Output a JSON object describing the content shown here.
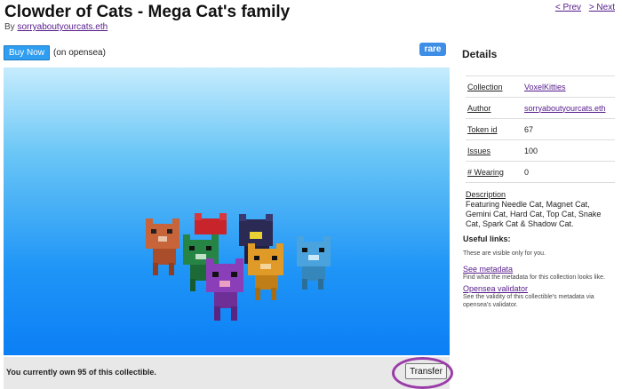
{
  "header": {
    "title": "Clowder of Cats - Mega Cat's family",
    "by_label": "By",
    "author": "sorryaboutyourcats.eth",
    "prev_label": "< Prev",
    "next_label": "> Next"
  },
  "purchase": {
    "buy_label": "Buy Now",
    "note": "(on opensea)",
    "rarity_badge": "rare"
  },
  "viewer": {
    "cats": [
      {
        "name": "Needle Cat",
        "color": "#c8643a"
      },
      {
        "name": "Magnet Cat",
        "color": "#c7252b"
      },
      {
        "name": "Gemini Cat",
        "color": "#268444"
      },
      {
        "name": "Hard Cat",
        "color": "#2a2a55"
      },
      {
        "name": "Top Cat",
        "color": "#e09a28"
      },
      {
        "name": "Snake Cat",
        "color": "#8a3fb8"
      },
      {
        "name": "Spark Cat",
        "color": "#4aa3dc"
      },
      {
        "name": "Shadow Cat",
        "color": "#444444"
      }
    ]
  },
  "footer": {
    "ownership": "You currently own 95 of this collectible.",
    "transfer_label": "Transfer",
    "highlight_color": "#9a3ca8"
  },
  "details": {
    "heading": "Details",
    "rows": [
      {
        "key": "Collection",
        "value": "VoxelKitties",
        "link": true
      },
      {
        "key": "Author",
        "value": "sorryaboutyourcats.eth",
        "link": true
      },
      {
        "key": "Token id",
        "value": "67",
        "link": false
      },
      {
        "key": "Issues",
        "value": "100",
        "link": false
      },
      {
        "key": "# Wearing",
        "value": "0",
        "link": false
      }
    ],
    "description_label": "Description",
    "description": "Featuring Needle Cat, Magnet Cat, Gemini Cat, Hard Cat, Top Cat, Snake Cat, Spark Cat & Shadow Cat."
  },
  "useful_links": {
    "heading": "Useful links:",
    "note": "These are visible only for you.",
    "metadata_label": "See metadata",
    "metadata_desc": "Find what the metadata for this collection looks like.",
    "validator_label": "Opensea validator",
    "validator_desc": "See the validity of this collectible's metadata via opensea's validator."
  },
  "colors": {
    "buy_button": "#2f9df0",
    "badge": "#3e8ee8",
    "link": "#551a8b"
  }
}
